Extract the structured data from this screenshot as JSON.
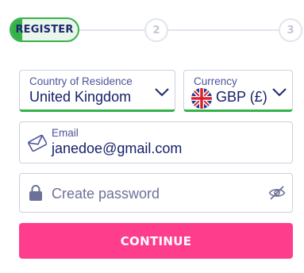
{
  "stepper": {
    "active_label": "REGISTER",
    "step2": "2",
    "step3": "3"
  },
  "country": {
    "label": "Country of Residence",
    "value": "United Kingdom"
  },
  "currency": {
    "label": "Currency",
    "value": "GBP (£)",
    "flag_icon": "uk-flag-icon"
  },
  "email": {
    "label": "Email",
    "value": "janedoe@gmail.com",
    "icon": "envelope-icon"
  },
  "password": {
    "placeholder": "Create password",
    "icon": "lock-icon",
    "toggle_icon": "eye-slash-icon"
  },
  "continue_label": "CONTINUE",
  "colors": {
    "accent_green": "#36b24a",
    "button_pink": "#ff3d8d",
    "text_navy": "#1f2a6b"
  }
}
